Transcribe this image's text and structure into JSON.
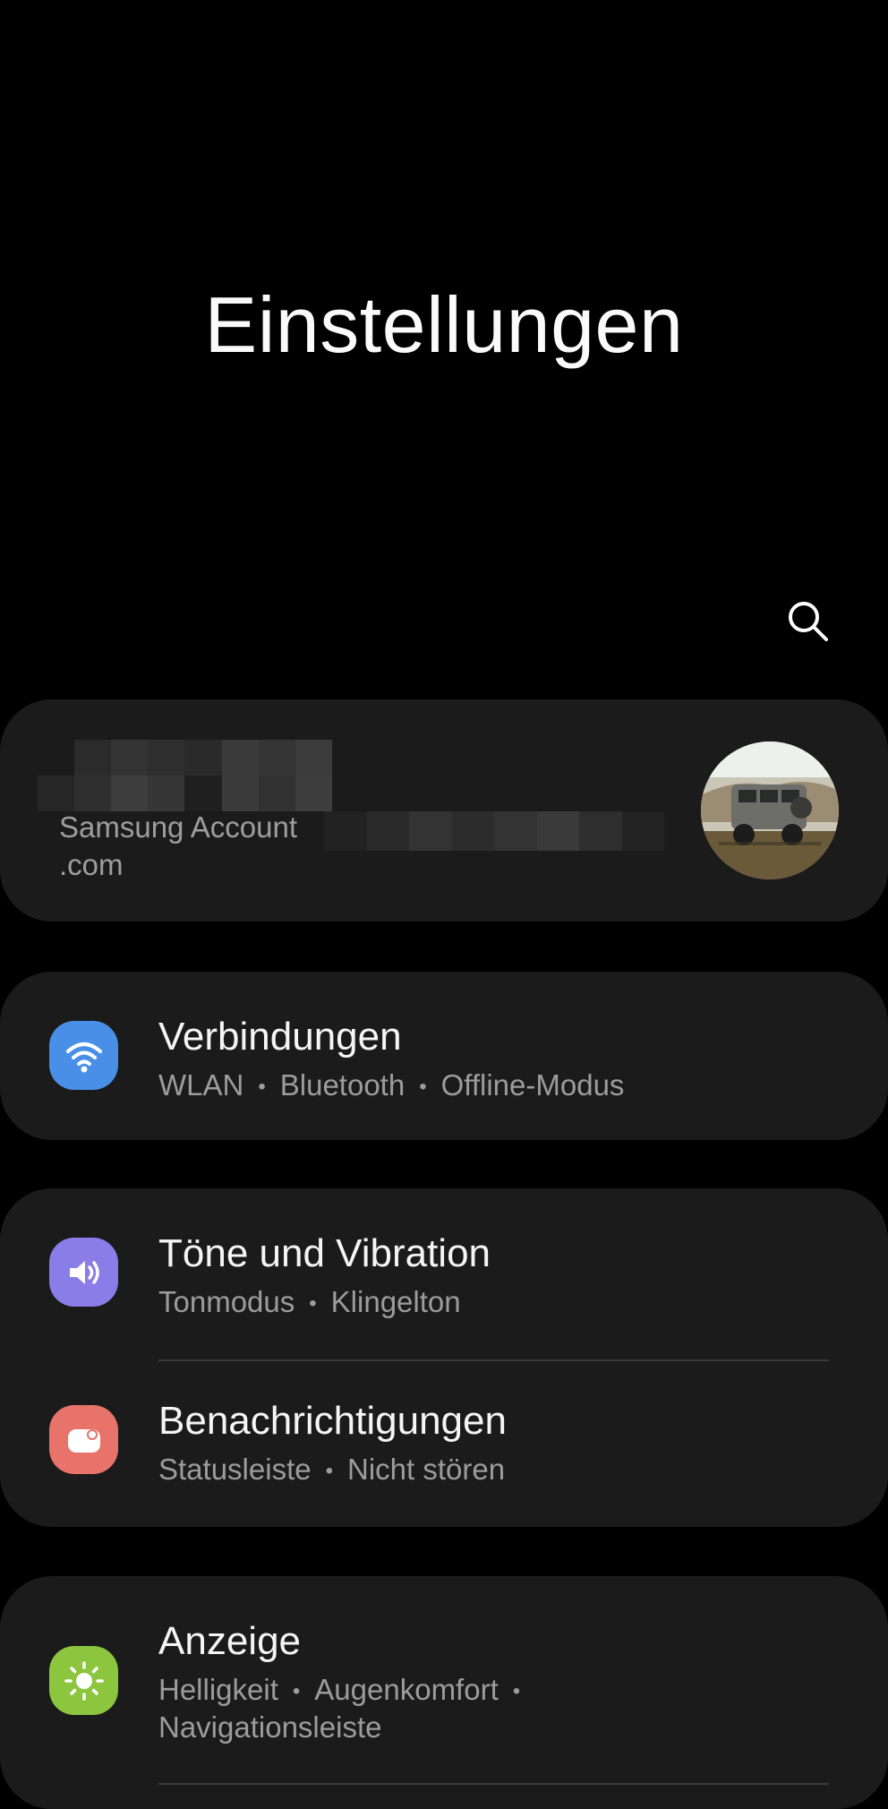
{
  "header": {
    "title": "Einstellungen",
    "search_icon": "search-icon"
  },
  "account": {
    "label": "Samsung Account",
    "email_suffix": ".com",
    "avatar": "profile-photo-suv"
  },
  "groups": [
    {
      "items": [
        {
          "title": "Verbindungen",
          "icon": "wifi-icon",
          "icon_color": "#4a8fe7",
          "subtitles": [
            "WLAN",
            "Bluetooth",
            "Offline-Modus"
          ]
        }
      ]
    },
    {
      "items": [
        {
          "title": "Töne und Vibration",
          "icon": "volume-icon",
          "icon_color": "#8a7de8",
          "subtitles": [
            "Tonmodus",
            "Klingelton"
          ]
        },
        {
          "title": "Benachrichtigungen",
          "icon": "notification-icon",
          "icon_color": "#e7736a",
          "subtitles": [
            "Statusleiste",
            "Nicht stören"
          ]
        }
      ]
    },
    {
      "items": [
        {
          "title": "Anzeige",
          "icon": "brightness-icon",
          "icon_color": "#8cc63f",
          "subtitles": [
            "Helligkeit",
            "Augenkomfort",
            "Navigationsleiste"
          ]
        }
      ]
    }
  ]
}
